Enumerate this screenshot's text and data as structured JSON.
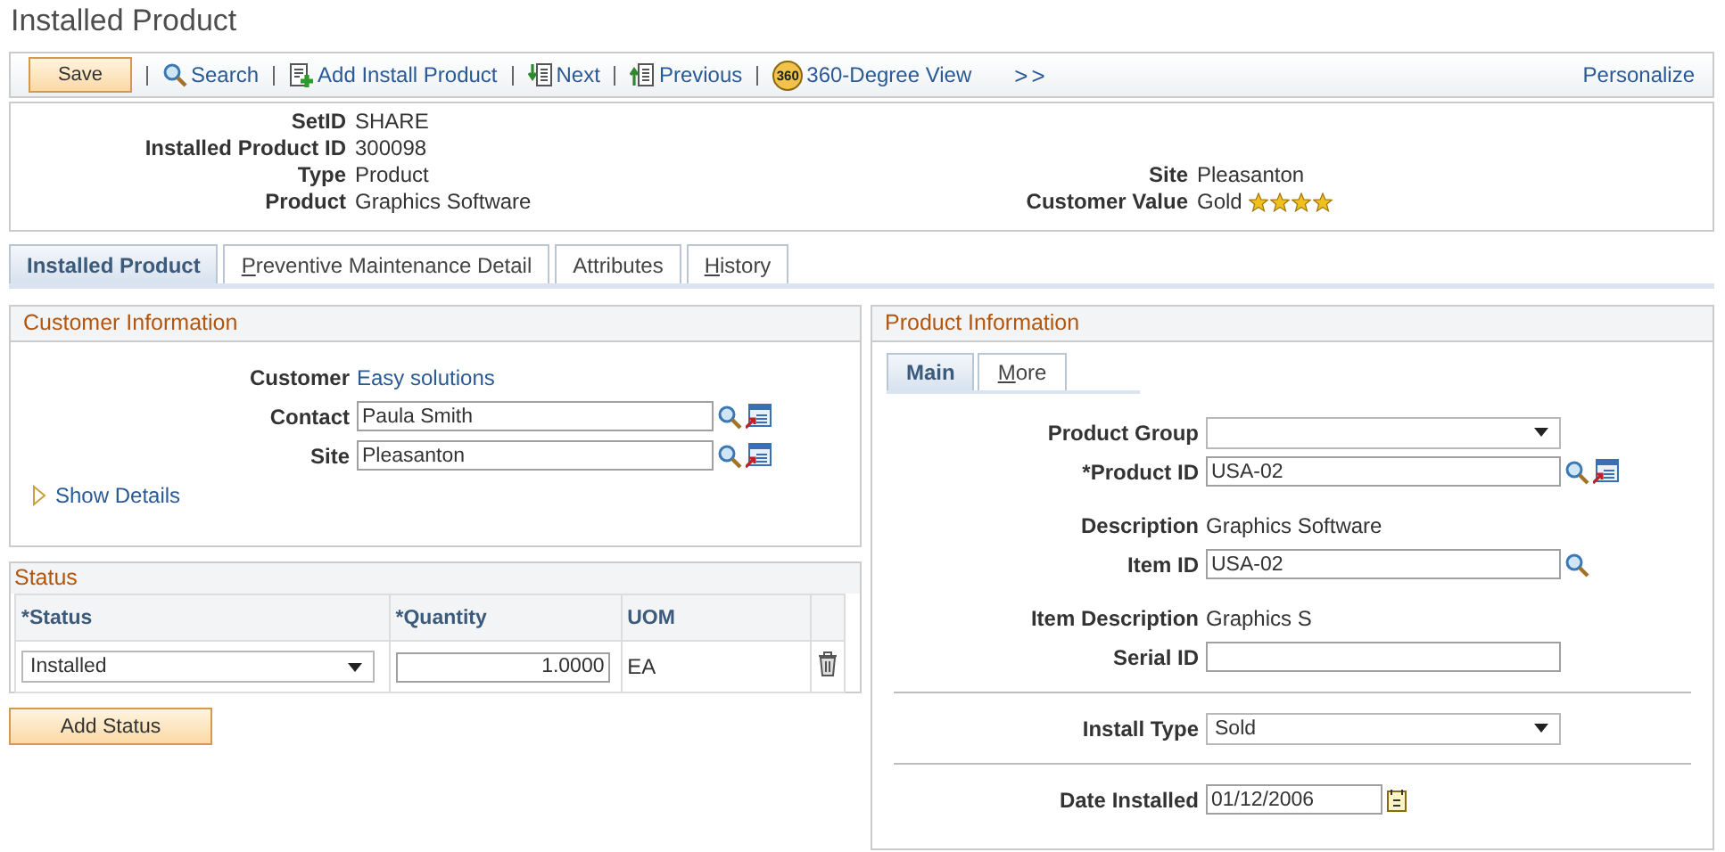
{
  "page_title": "Installed Product",
  "toolbar": {
    "save": "Save",
    "personalize": "Personalize",
    "items": [
      {
        "kind": "search",
        "label": "Search"
      },
      {
        "kind": "add",
        "label": "Add Install Product"
      },
      {
        "kind": "next",
        "label": "Next"
      },
      {
        "kind": "previous",
        "label": "Previous"
      },
      {
        "kind": "view",
        "badge": "360",
        "label": "360-Degree View"
      },
      {
        "kind": "more",
        "label": ">>"
      }
    ]
  },
  "header": {
    "left": [
      {
        "label": "SetID",
        "value": "SHARE"
      },
      {
        "label": "Installed Product ID",
        "value": "300098"
      },
      {
        "label": "Type",
        "value": "Product"
      },
      {
        "label": "Product",
        "value": "Graphics Software"
      }
    ],
    "right": [
      {
        "label": "Site",
        "value": "Pleasanton"
      },
      {
        "label": "Customer Value",
        "value": "Gold",
        "stars": 4
      }
    ]
  },
  "tabs": [
    {
      "label": "Installed Product",
      "selected": true,
      "underline_first": false
    },
    {
      "label": "Preventive Maintenance Detail",
      "selected": false,
      "underline_first": true
    },
    {
      "label": "Attributes",
      "selected": false,
      "underline_first": false
    },
    {
      "label": "History",
      "selected": false,
      "underline_first": true
    }
  ],
  "customer": {
    "title": "Customer Information",
    "rows": [
      {
        "kind": "link",
        "label": "Customer",
        "value": "Easy solutions"
      },
      {
        "kind": "input",
        "label": "Contact",
        "value": "Paula Smith",
        "lookup": true,
        "detail": true
      },
      {
        "kind": "input",
        "label": "Site",
        "value": "Pleasanton",
        "lookup": true,
        "detail": true
      }
    ],
    "show_details": "Show Details"
  },
  "status": {
    "title": "Status",
    "columns": [
      "*Status",
      "*Quantity",
      "UOM"
    ],
    "rows": [
      {
        "status": "Installed",
        "quantity": "1.0000",
        "uom": "EA"
      }
    ],
    "add_button": "Add Status"
  },
  "product": {
    "title": "Product Information",
    "tabs": [
      {
        "label": "Main",
        "selected": true,
        "underline_first": false
      },
      {
        "label": "More",
        "selected": false,
        "underline_first": true
      }
    ],
    "rows": [
      {
        "kind": "select",
        "label": "Product Group",
        "value": ""
      },
      {
        "kind": "input",
        "label": "*Product ID",
        "value": "USA-02",
        "lookup": true,
        "detail": true
      },
      {
        "kind": "text",
        "label": "Description",
        "value": "Graphics Software"
      },
      {
        "kind": "input",
        "label": "Item ID",
        "value": "USA-02",
        "lookup": true,
        "detail": false
      },
      {
        "kind": "text",
        "label": "Item Description",
        "value": "Graphics S"
      },
      {
        "kind": "input",
        "label": "Serial ID",
        "value": "",
        "lookup": false,
        "detail": false
      },
      {
        "kind": "divider"
      },
      {
        "kind": "select",
        "label": "Install Type",
        "value": "Sold"
      },
      {
        "kind": "divider"
      },
      {
        "kind": "date",
        "label": "Date Installed",
        "value": "01/12/2006"
      }
    ]
  }
}
